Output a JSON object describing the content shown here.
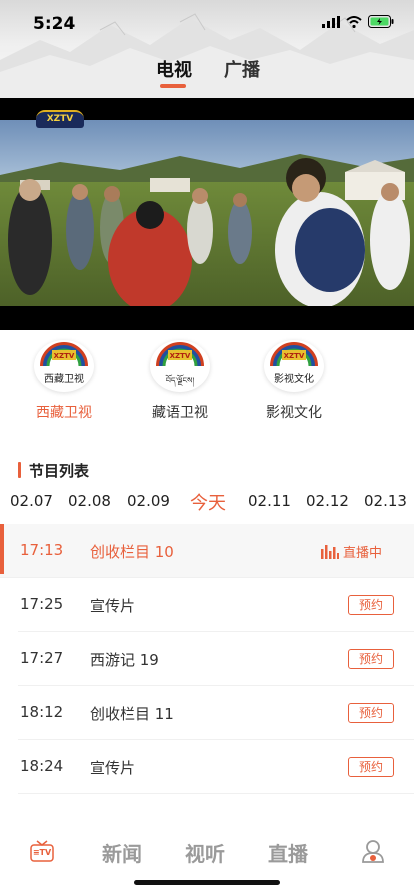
{
  "status": {
    "time": "5:24"
  },
  "top_tabs": [
    {
      "label": "电视",
      "active": true
    },
    {
      "label": "广播",
      "active": false
    }
  ],
  "video": {
    "logo_text": "XZTV"
  },
  "channels": [
    {
      "name": "西藏卫视",
      "logo_label": "西藏卫视",
      "active": true
    },
    {
      "name": "藏语卫视",
      "logo_label": "བོད་ལྗོངས།",
      "active": false
    },
    {
      "name": "影视文化",
      "logo_label": "影视文化",
      "active": false
    }
  ],
  "section": {
    "title": "节目列表"
  },
  "dates": [
    "02.07",
    "02.08",
    "02.09",
    "今天",
    "02.11",
    "02.12",
    "02.13"
  ],
  "active_date": "今天",
  "programs": [
    {
      "time": "17:13",
      "title": "创收栏目 10",
      "status": "直播中",
      "live": true
    },
    {
      "time": "17:25",
      "title": "宣传片",
      "status": "预约",
      "live": false
    },
    {
      "time": "17:27",
      "title": "西游记 19",
      "status": "预约",
      "live": false
    },
    {
      "time": "18:12",
      "title": "创收栏目 11",
      "status": "预约",
      "live": false
    },
    {
      "time": "18:24",
      "title": "宣传片",
      "status": "预约",
      "live": false
    }
  ],
  "bottom_nav": {
    "tv_icon_text": "≡TV",
    "items": [
      "新闻",
      "视听",
      "直播"
    ]
  },
  "colors": {
    "accent": "#e8603c",
    "text": "#222222",
    "muted": "#9a9a9a"
  },
  "icons": [
    "signal-icon",
    "wifi-icon",
    "battery-icon",
    "equalizer-icon",
    "tv-icon",
    "profile-icon"
  ]
}
